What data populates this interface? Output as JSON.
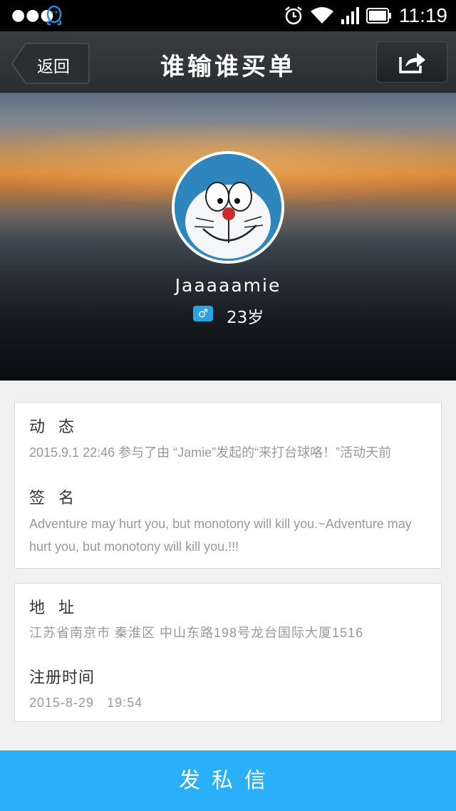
{
  "status_bar": {
    "time": "11:19",
    "icons": [
      "more-dots-icon",
      "qq-penguin-icon",
      "alarm-icon",
      "wifi-icon",
      "signal-icon",
      "battery-icon"
    ]
  },
  "nav": {
    "back_label": "返回",
    "title": "谁输谁买单",
    "share_icon": "share-icon"
  },
  "profile": {
    "username": "Jaaaaamie",
    "gender_symbol": "♂",
    "age": "23岁"
  },
  "sections": {
    "activity_label": "动 态",
    "activity_value": "2015.9.1 22:46 参与了由 “Jamie”发起的“来打台球咯！”活动天前",
    "signature_label": "签 名",
    "signature_value": "Adventure may hurt you, but monotony will kill you.~Adventure may hurt you, but monotony will kill you.!!!",
    "address_label": "地 址",
    "address_value": "江苏省南京市 秦淮区 中山东路198号龙台国际大厦1516",
    "register_label": "注册时间",
    "register_value": "2015-8-29   19:54"
  },
  "actions": {
    "send_message": "发私信"
  },
  "colors": {
    "accent": "#2ab0f8",
    "gender_badge": "#2aa3e2",
    "navbar": "#2f3235"
  }
}
